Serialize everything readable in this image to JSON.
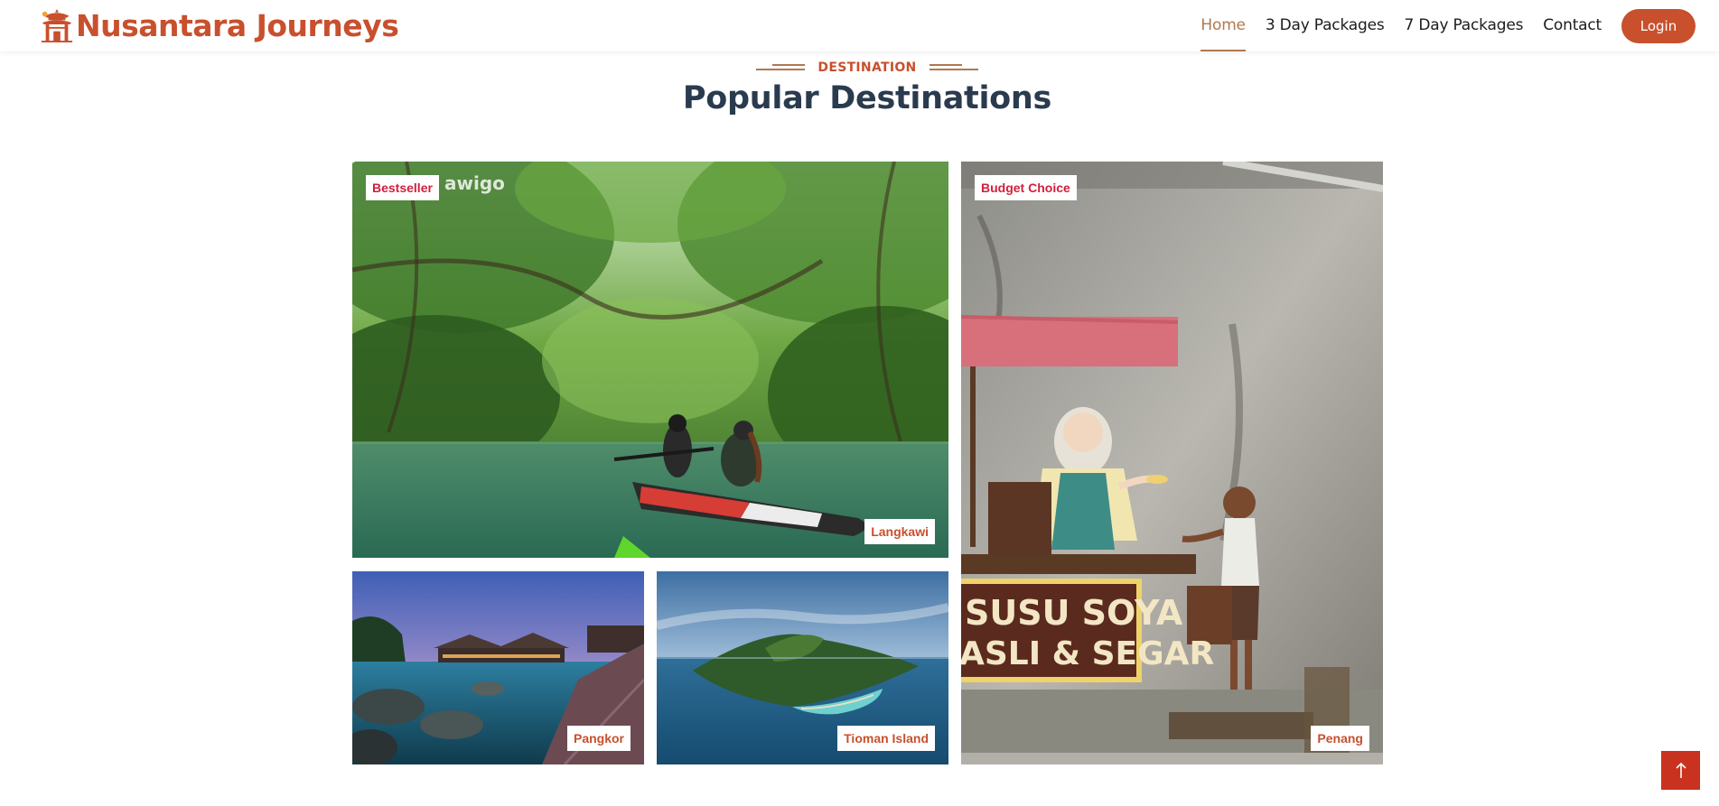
{
  "brand": {
    "name": "Nusantara Journeys",
    "logo_icon": "pagoda-gate-icon",
    "color": "#c8502d"
  },
  "nav": {
    "links": [
      {
        "label": "Home",
        "active": true
      },
      {
        "label": "3 Day Packages",
        "active": false
      },
      {
        "label": "7 Day Packages",
        "active": false
      },
      {
        "label": "Contact",
        "active": false
      }
    ],
    "login_label": "Login"
  },
  "section": {
    "eyebrow": "DESTINATION",
    "title": "Popular Destinations"
  },
  "destinations": {
    "langkawi": {
      "badge": "Bestseller",
      "name": "Langkawi",
      "watermark": "awigo"
    },
    "penang": {
      "badge": "Budget Choice",
      "name": "Penang",
      "mural_sign": [
        "SUSU SOYA",
        "ASLI & SEGAR"
      ]
    },
    "pangkor": {
      "name": "Pangkor"
    },
    "tioman": {
      "name": "Tioman Island"
    }
  },
  "colors": {
    "accent": "#c8502d",
    "badge_red": "#d21f3c",
    "title": "#2a3b4f",
    "active_nav": "#b07850"
  },
  "back_to_top": {
    "icon": "arrow-up-icon"
  }
}
